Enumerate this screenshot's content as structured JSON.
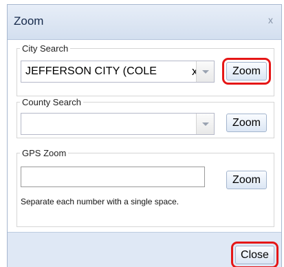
{
  "dialog": {
    "title": "Zoom",
    "close_glyph": "x"
  },
  "city_search": {
    "legend": "City Search",
    "value": "JEFFERSON CITY (COLE",
    "clear_glyph": "x",
    "button_label": "Zoom"
  },
  "county_search": {
    "legend": "County Search",
    "value": "",
    "button_label": "Zoom"
  },
  "gps_zoom": {
    "legend": "GPS Zoom",
    "value": "",
    "button_label": "Zoom",
    "hint": "Separate each number with a single space."
  },
  "footer": {
    "close_label": "Close"
  },
  "colors": {
    "highlight": "#e51616",
    "title_text": "#15294b",
    "footer_bg": "#dfe8f5"
  }
}
